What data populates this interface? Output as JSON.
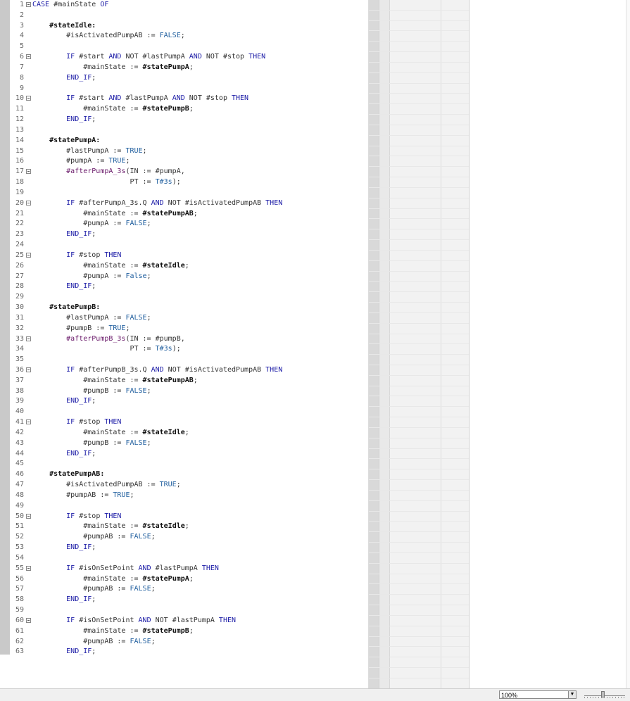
{
  "editor": {
    "lines": [
      {
        "n": "1",
        "fold": true,
        "tokens": [
          [
            "kw",
            "CASE"
          ],
          [
            "var",
            " #mainState "
          ],
          [
            "kw",
            "OF"
          ]
        ]
      },
      {
        "n": "2",
        "tokens": []
      },
      {
        "n": "3",
        "tokens": [
          [
            "state",
            "    #stateIdle:"
          ]
        ]
      },
      {
        "n": "4",
        "tokens": [
          [
            "var",
            "        #isActivatedPumpAB := "
          ],
          [
            "const",
            "FALSE"
          ],
          [
            "op",
            ";"
          ]
        ]
      },
      {
        "n": "5",
        "tokens": []
      },
      {
        "n": "6",
        "fold": true,
        "tokens": [
          [
            "kw",
            "        IF"
          ],
          [
            "var",
            " #start "
          ],
          [
            "kw",
            "AND"
          ],
          [
            "var",
            " NOT #lastPumpA "
          ],
          [
            "kw",
            "AND"
          ],
          [
            "var",
            " NOT #stop "
          ],
          [
            "kw",
            "THEN"
          ]
        ]
      },
      {
        "n": "7",
        "tokens": [
          [
            "var",
            "            #mainState := "
          ],
          [
            "state",
            "#statePumpA"
          ],
          [
            "op",
            ";"
          ]
        ]
      },
      {
        "n": "8",
        "tokens": [
          [
            "kw",
            "        END_IF"
          ],
          [
            "op",
            ";"
          ]
        ]
      },
      {
        "n": "9",
        "tokens": []
      },
      {
        "n": "10",
        "fold": true,
        "tokens": [
          [
            "kw",
            "        IF"
          ],
          [
            "var",
            " #start "
          ],
          [
            "kw",
            "AND"
          ],
          [
            "var",
            " #lastPumpA "
          ],
          [
            "kw",
            "AND"
          ],
          [
            "var",
            " NOT #stop "
          ],
          [
            "kw",
            "THEN"
          ]
        ]
      },
      {
        "n": "11",
        "tokens": [
          [
            "var",
            "            #mainState := "
          ],
          [
            "state",
            "#statePumpB"
          ],
          [
            "op",
            ";"
          ]
        ]
      },
      {
        "n": "12",
        "tokens": [
          [
            "kw",
            "        END_IF"
          ],
          [
            "op",
            ";"
          ]
        ]
      },
      {
        "n": "13",
        "tokens": []
      },
      {
        "n": "14",
        "tokens": [
          [
            "state",
            "    #statePumpA:"
          ]
        ]
      },
      {
        "n": "15",
        "tokens": [
          [
            "var",
            "        #lastPumpA := "
          ],
          [
            "const",
            "TRUE"
          ],
          [
            "op",
            ";"
          ]
        ]
      },
      {
        "n": "16",
        "tokens": [
          [
            "var",
            "        #pumpA := "
          ],
          [
            "const",
            "TRUE"
          ],
          [
            "op",
            ";"
          ]
        ]
      },
      {
        "n": "17",
        "fold": true,
        "tokens": [
          [
            "fb",
            "        #afterPumpA_3s"
          ],
          [
            "op",
            "(IN := #pumpA,"
          ]
        ]
      },
      {
        "n": "18",
        "tokens": [
          [
            "op",
            "                       PT := "
          ],
          [
            "const",
            "T#3s"
          ],
          [
            "op",
            ");"
          ]
        ]
      },
      {
        "n": "19",
        "tokens": []
      },
      {
        "n": "20",
        "fold": true,
        "tokens": [
          [
            "kw",
            "        IF"
          ],
          [
            "var",
            " #afterPumpA_3s.Q "
          ],
          [
            "kw",
            "AND"
          ],
          [
            "var",
            " NOT #isActivatedPumpAB "
          ],
          [
            "kw",
            "THEN"
          ]
        ]
      },
      {
        "n": "21",
        "tokens": [
          [
            "var",
            "            #mainState := "
          ],
          [
            "state",
            "#statePumpAB"
          ],
          [
            "op",
            ";"
          ]
        ]
      },
      {
        "n": "22",
        "tokens": [
          [
            "var",
            "            #pumpA := "
          ],
          [
            "const",
            "FALSE"
          ],
          [
            "op",
            ";"
          ]
        ]
      },
      {
        "n": "23",
        "tokens": [
          [
            "kw",
            "        END_IF"
          ],
          [
            "op",
            ";"
          ]
        ]
      },
      {
        "n": "24",
        "tokens": []
      },
      {
        "n": "25",
        "fold": true,
        "tokens": [
          [
            "kw",
            "        IF"
          ],
          [
            "var",
            " #stop "
          ],
          [
            "kw",
            "THEN"
          ]
        ]
      },
      {
        "n": "26",
        "tokens": [
          [
            "var",
            "            #mainState := "
          ],
          [
            "state",
            "#stateIdle"
          ],
          [
            "op",
            ";"
          ]
        ]
      },
      {
        "n": "27",
        "tokens": [
          [
            "var",
            "            #pumpA := "
          ],
          [
            "const",
            "False"
          ],
          [
            "op",
            ";"
          ]
        ]
      },
      {
        "n": "28",
        "tokens": [
          [
            "kw",
            "        END_IF"
          ],
          [
            "op",
            ";"
          ]
        ]
      },
      {
        "n": "29",
        "tokens": []
      },
      {
        "n": "30",
        "tokens": [
          [
            "state",
            "    #statePumpB:"
          ]
        ]
      },
      {
        "n": "31",
        "tokens": [
          [
            "var",
            "        #lastPumpA := "
          ],
          [
            "const",
            "FALSE"
          ],
          [
            "op",
            ";"
          ]
        ]
      },
      {
        "n": "32",
        "tokens": [
          [
            "var",
            "        #pumpB := "
          ],
          [
            "const",
            "TRUE"
          ],
          [
            "op",
            ";"
          ]
        ]
      },
      {
        "n": "33",
        "fold": true,
        "tokens": [
          [
            "fb",
            "        #afterPumpB_3s"
          ],
          [
            "op",
            "(IN := #pumpB,"
          ]
        ]
      },
      {
        "n": "34",
        "tokens": [
          [
            "op",
            "                       PT := "
          ],
          [
            "const",
            "T#3s"
          ],
          [
            "op",
            ");"
          ]
        ]
      },
      {
        "n": "35",
        "tokens": []
      },
      {
        "n": "36",
        "fold": true,
        "tokens": [
          [
            "kw",
            "        IF"
          ],
          [
            "var",
            " #afterPumpB_3s.Q "
          ],
          [
            "kw",
            "AND"
          ],
          [
            "var",
            " NOT #isActivatedPumpAB "
          ],
          [
            "kw",
            "THEN"
          ]
        ]
      },
      {
        "n": "37",
        "tokens": [
          [
            "var",
            "            #mainState := "
          ],
          [
            "state",
            "#statePumpAB"
          ],
          [
            "op",
            ";"
          ]
        ]
      },
      {
        "n": "38",
        "tokens": [
          [
            "var",
            "            #pumpB := "
          ],
          [
            "const",
            "FALSE"
          ],
          [
            "op",
            ";"
          ]
        ]
      },
      {
        "n": "39",
        "tokens": [
          [
            "kw",
            "        END_IF"
          ],
          [
            "op",
            ";"
          ]
        ]
      },
      {
        "n": "40",
        "tokens": []
      },
      {
        "n": "41",
        "fold": true,
        "tokens": [
          [
            "kw",
            "        IF"
          ],
          [
            "var",
            " #stop "
          ],
          [
            "kw",
            "THEN"
          ]
        ]
      },
      {
        "n": "42",
        "tokens": [
          [
            "var",
            "            #mainState := "
          ],
          [
            "state",
            "#stateIdle"
          ],
          [
            "op",
            ";"
          ]
        ]
      },
      {
        "n": "43",
        "tokens": [
          [
            "var",
            "            #pumpB := "
          ],
          [
            "const",
            "FALSE"
          ],
          [
            "op",
            ";"
          ]
        ]
      },
      {
        "n": "44",
        "tokens": [
          [
            "kw",
            "        END_IF"
          ],
          [
            "op",
            ";"
          ]
        ]
      },
      {
        "n": "45",
        "tokens": []
      },
      {
        "n": "46",
        "tokens": [
          [
            "state",
            "    #statePumpAB:"
          ]
        ]
      },
      {
        "n": "47",
        "tokens": [
          [
            "var",
            "        #isActivatedPumpAB := "
          ],
          [
            "const",
            "TRUE"
          ],
          [
            "op",
            ";"
          ]
        ]
      },
      {
        "n": "48",
        "tokens": [
          [
            "var",
            "        #pumpAB := "
          ],
          [
            "const",
            "TRUE"
          ],
          [
            "op",
            ";"
          ]
        ]
      },
      {
        "n": "49",
        "tokens": []
      },
      {
        "n": "50",
        "fold": true,
        "tokens": [
          [
            "kw",
            "        IF"
          ],
          [
            "var",
            " #stop "
          ],
          [
            "kw",
            "THEN"
          ]
        ]
      },
      {
        "n": "51",
        "tokens": [
          [
            "var",
            "            #mainState := "
          ],
          [
            "state",
            "#stateIdle"
          ],
          [
            "op",
            ";"
          ]
        ]
      },
      {
        "n": "52",
        "tokens": [
          [
            "var",
            "            #pumpAB := "
          ],
          [
            "const",
            "FALSE"
          ],
          [
            "op",
            ";"
          ]
        ]
      },
      {
        "n": "53",
        "tokens": [
          [
            "kw",
            "        END_IF"
          ],
          [
            "op",
            ";"
          ]
        ]
      },
      {
        "n": "54",
        "tokens": []
      },
      {
        "n": "55",
        "fold": true,
        "tokens": [
          [
            "kw",
            "        IF"
          ],
          [
            "var",
            " #isOnSetPoint "
          ],
          [
            "kw",
            "AND"
          ],
          [
            "var",
            " #lastPumpA "
          ],
          [
            "kw",
            "THEN"
          ]
        ]
      },
      {
        "n": "56",
        "tokens": [
          [
            "var",
            "            #mainState := "
          ],
          [
            "state",
            "#statePumpA"
          ],
          [
            "op",
            ";"
          ]
        ]
      },
      {
        "n": "57",
        "tokens": [
          [
            "var",
            "            #pumpAB := "
          ],
          [
            "const",
            "FALSE"
          ],
          [
            "op",
            ";"
          ]
        ]
      },
      {
        "n": "58",
        "tokens": [
          [
            "kw",
            "        END_IF"
          ],
          [
            "op",
            ";"
          ]
        ]
      },
      {
        "n": "59",
        "tokens": []
      },
      {
        "n": "60",
        "fold": true,
        "tokens": [
          [
            "kw",
            "        IF"
          ],
          [
            "var",
            " #isOnSetPoint "
          ],
          [
            "kw",
            "AND"
          ],
          [
            "var",
            " NOT #lastPumpA "
          ],
          [
            "kw",
            "THEN"
          ]
        ]
      },
      {
        "n": "61",
        "tokens": [
          [
            "var",
            "            #mainState := "
          ],
          [
            "state",
            "#statePumpB"
          ],
          [
            "op",
            ";"
          ]
        ]
      },
      {
        "n": "62",
        "tokens": [
          [
            "var",
            "            #pumpAB := "
          ],
          [
            "const",
            "FALSE"
          ],
          [
            "op",
            ";"
          ]
        ]
      },
      {
        "n": "63",
        "tokens": [
          [
            "kw",
            "        END_IF"
          ],
          [
            "op",
            ";"
          ]
        ]
      }
    ]
  },
  "statusbar": {
    "zoom_value": "100%",
    "zoom_dropdown_icon": "chevron-down-icon"
  },
  "colors": {
    "keyword": "#1a1aa6",
    "constant": "#1f5e9e",
    "function_block": "#6a1a6a",
    "state_label": "#111111"
  }
}
